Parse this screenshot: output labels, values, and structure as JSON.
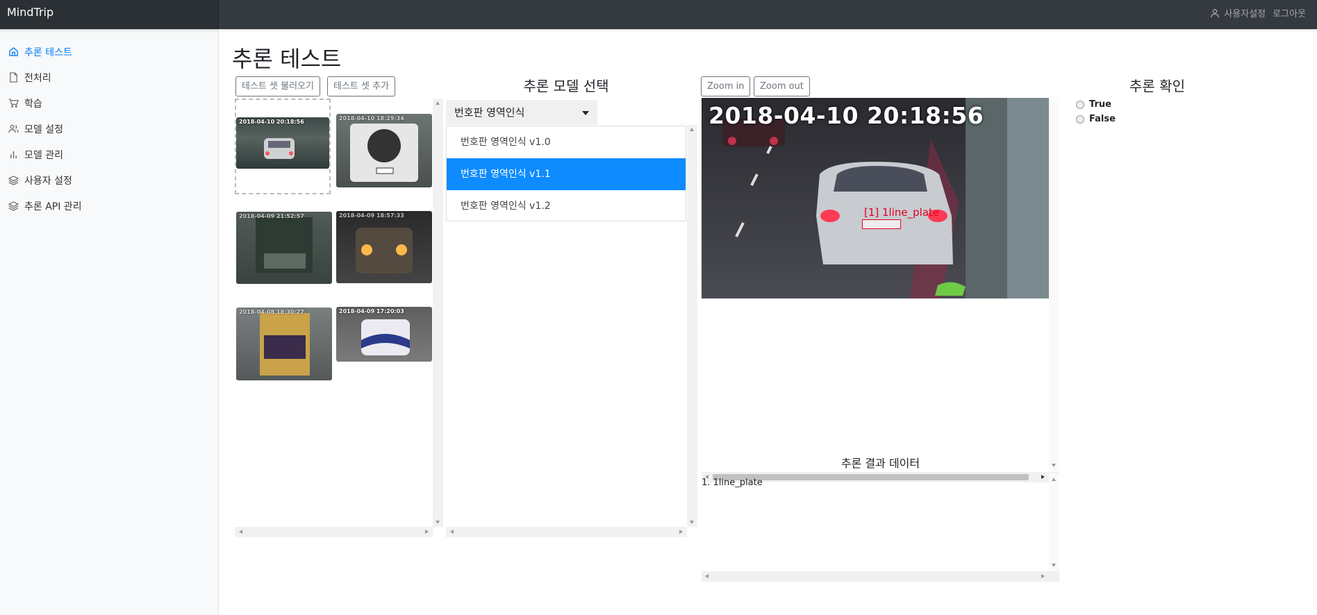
{
  "app": {
    "brand": "MindTrip"
  },
  "topbar": {
    "user_settings": "사용자설정",
    "logout": "로그아웃"
  },
  "sidebar": {
    "items": [
      {
        "label": "추론 테스트",
        "icon": "home-icon",
        "active": true
      },
      {
        "label": "전처리",
        "icon": "file-icon",
        "active": false
      },
      {
        "label": "학습",
        "icon": "cart-icon",
        "active": false
      },
      {
        "label": "모델 설정",
        "icon": "users-icon",
        "active": false
      },
      {
        "label": "모델 관리",
        "icon": "bar-chart-icon",
        "active": false
      },
      {
        "label": "사용자 설정",
        "icon": "layers-icon",
        "active": false
      },
      {
        "label": "추론 API 관리",
        "icon": "layers-icon",
        "active": false
      }
    ]
  },
  "page": {
    "title": "추론 테스트"
  },
  "testset": {
    "load_label": "테스트 셋 불러오기",
    "add_label": "테스트 셋 추가",
    "thumbnails": [
      {
        "timestamp": "2018-04-10 20:18:56",
        "selected": true
      },
      {
        "timestamp": "2018-04-10 18:29:34",
        "selected": false
      },
      {
        "timestamp": "2018-04-09 21:52:57",
        "selected": false
      },
      {
        "timestamp": "2018-04-09 18:57:33",
        "selected": false
      },
      {
        "timestamp": "2018-04-08 18:30:27",
        "selected": false
      },
      {
        "timestamp": "2018-04-09 17:20:03",
        "selected": false
      }
    ]
  },
  "model_select": {
    "title": "추론 모델 선택",
    "current": "번호판 영역인식",
    "options": [
      "번호판 영역인식 v1.0",
      "번호판 영역인식 v1.1",
      "번호판 영역인식 v1.2"
    ],
    "active_index": 1
  },
  "viewer": {
    "zoom_in": "Zoom in",
    "zoom_out": "Zoom out",
    "timestamp": "2018-04-10 20:18:56",
    "bbox_label": "[1] 1line_plate"
  },
  "result": {
    "title": "추론 결과 데이터",
    "text": "1. 1line_plate"
  },
  "confirm": {
    "title": "추론 확인",
    "options": [
      "True",
      "False"
    ]
  },
  "colors": {
    "accent": "#007bff",
    "selected": "#0d8bff",
    "topbar": "#343a40",
    "bbox": "#e0001e"
  }
}
